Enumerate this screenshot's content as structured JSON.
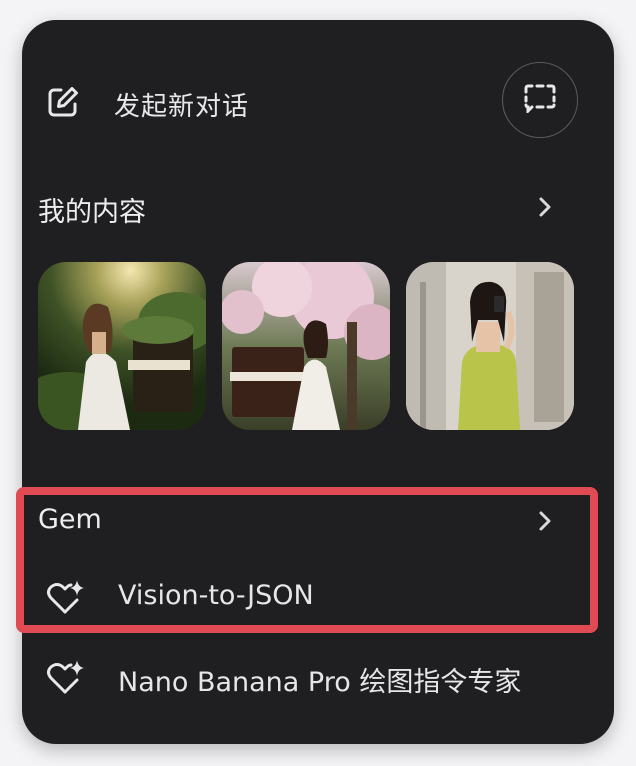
{
  "menu": {
    "new_chat": {
      "label": "发起新对话",
      "icon": "edit-icon"
    },
    "temporary_chat": {
      "icon": "temporary-chat-icon"
    }
  },
  "my_content": {
    "title": "我的内容",
    "chevron_icon": "chevron-right-icon",
    "thumbnails": [
      {
        "icon": "image-thumbnail"
      },
      {
        "icon": "image-thumbnail"
      },
      {
        "icon": "image-thumbnail"
      }
    ]
  },
  "gem": {
    "title": "Gem",
    "chevron_icon": "chevron-right-icon",
    "items": [
      {
        "label": "Vision-to-JSON",
        "icon": "gem-sparkle-icon"
      },
      {
        "label": "Nano Banana Pro 绘图指令专家",
        "icon": "gem-sparkle-icon"
      }
    ]
  },
  "colors": {
    "panel_bg": "#1f1f21",
    "text": "#e8e8ea",
    "highlight": "#e04a52"
  }
}
